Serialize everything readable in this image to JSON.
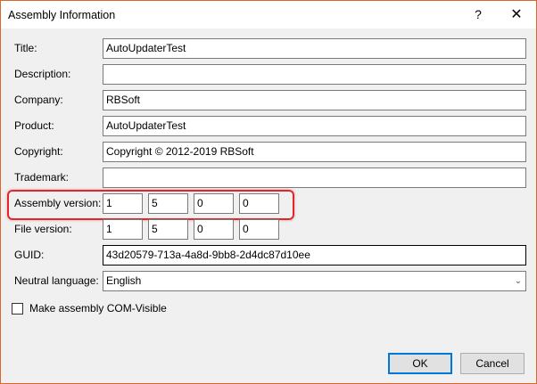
{
  "window": {
    "title": "Assembly Information",
    "help": "?",
    "close": "✕"
  },
  "fields": {
    "title": {
      "label": "Title:",
      "value": "AutoUpdaterTest"
    },
    "description": {
      "label": "Description:",
      "value": ""
    },
    "company": {
      "label": "Company:",
      "value": "RBSoft"
    },
    "product": {
      "label": "Product:",
      "value": "AutoUpdaterTest"
    },
    "copyright": {
      "label": "Copyright:",
      "value": "Copyright © 2012-2019 RBSoft"
    },
    "trademark": {
      "label": "Trademark:",
      "value": ""
    },
    "assembly_version": {
      "label": "Assembly version:",
      "parts": [
        "1",
        "5",
        "0",
        "0"
      ]
    },
    "file_version": {
      "label": "File version:",
      "parts": [
        "1",
        "5",
        "0",
        "0"
      ]
    },
    "guid": {
      "label": "GUID:",
      "value": "43d20579-713a-4a8d-9bb8-2d4dc87d10ee"
    },
    "neutral_language": {
      "label": "Neutral language:",
      "value": "English"
    }
  },
  "com_visible": {
    "label": "Make assembly COM-Visible",
    "checked": false
  },
  "buttons": {
    "ok": "OK",
    "cancel": "Cancel"
  },
  "colors": {
    "highlight": "#e3262b",
    "focus": "#0078d7",
    "border": "#d9692b"
  }
}
